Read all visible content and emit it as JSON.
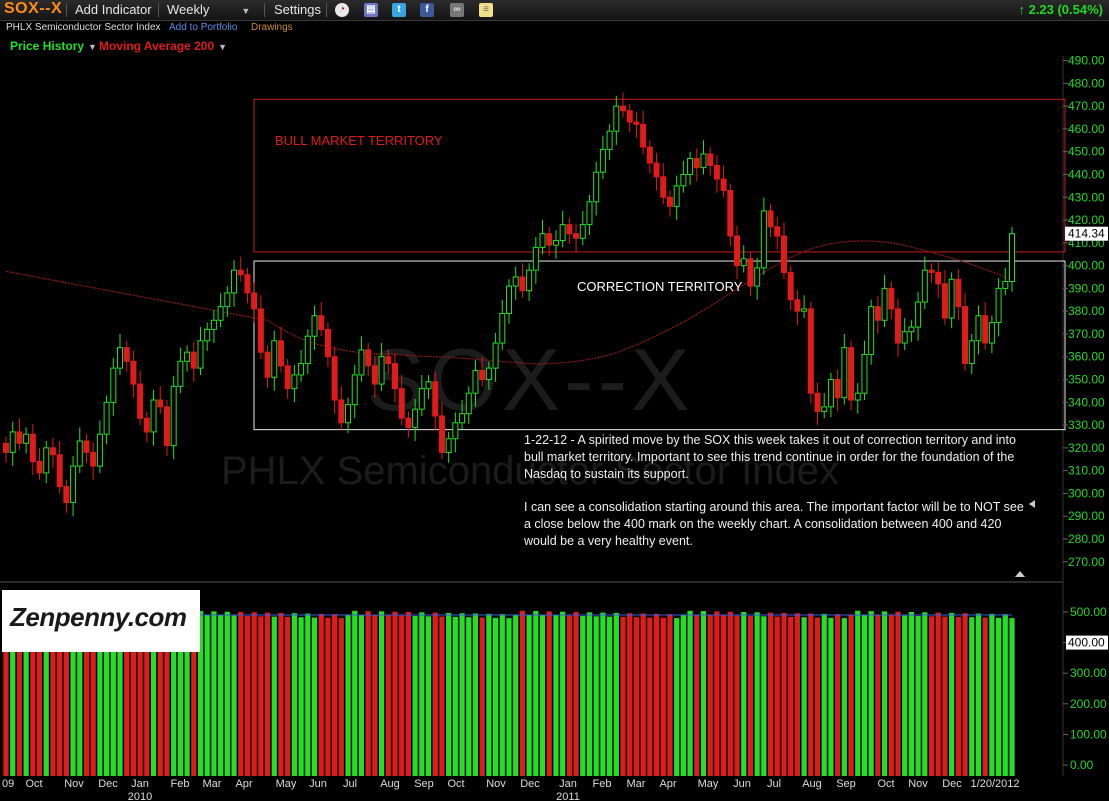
{
  "toolbar": {
    "symbol": "SOX--X",
    "add_indicator": "Add Indicator",
    "period": "Weekly",
    "settings": "Settings",
    "change": "↑ 2.23 (0.54%)"
  },
  "subbar": {
    "name": "PHLX Semiconductor Sector Index",
    "add_to_portfolio": "Add to Portfolio",
    "drawings": "Drawings"
  },
  "indicators": {
    "price_history": "Price History",
    "moving_average": "Moving Average 200"
  },
  "watermark": {
    "symbol": "SOX--X",
    "name": "PHLX Semiconductor Sector Index"
  },
  "annotations": {
    "bull": "BULL MARKET TERRITORY",
    "correction": "CORRECTION TERRITORY",
    "note_1": "1-22-12 - A spirited move by the SOX this week takes it out of correction territory and into bull market territory. Important to see this trend continue in order for the foundation of the Nasdaq to sustain its support.",
    "note_2": "I can see a consolidation starting around this area. The important factor will be to NOT see a close below the 400 mark on the weekly chart. A consolidation between 400 and 420 would be a very healthy event."
  },
  "logo_text": "Zenpenny.com",
  "colors": {
    "up": "#22e022",
    "down": "#e01b1b",
    "ma": "#8b1a1a",
    "axis_text": "#23d623",
    "symbol": "#ff8c1a",
    "volume_line": "#3b5bdb"
  },
  "chart_data": [
    {
      "type": "candlestick",
      "title": "SOX--X",
      "ylim": [
        262,
        492
      ],
      "y_ticks": [
        270,
        280,
        290,
        300,
        310,
        320,
        330,
        340,
        350,
        360,
        370,
        380,
        390,
        400,
        410,
        420,
        430,
        440,
        450,
        460,
        470,
        480,
        490
      ],
      "last_price_label": "414.34",
      "x_tick_labels": [
        "09",
        "Oct",
        "Nov",
        "Dec",
        "Jan",
        "Feb",
        "Mar",
        "Apr",
        "May",
        "Jun",
        "Jul",
        "Aug",
        "Sep",
        "Oct",
        "Nov",
        "Dec",
        "Jan",
        "Feb",
        "Mar",
        "Apr",
        "May",
        "Jun",
        "Jul",
        "Aug",
        "Sep",
        "Oct",
        "Nov",
        "Dec",
        "1/20/2012"
      ],
      "year_labels": [
        "2010",
        "2011"
      ],
      "close": [
        318,
        327,
        322,
        326,
        314,
        309,
        320,
        317,
        303,
        296,
        312,
        323,
        318,
        312,
        326,
        340,
        355,
        364,
        358,
        348,
        333,
        327,
        341,
        338,
        321,
        347,
        358,
        362,
        355,
        367,
        372,
        376,
        382,
        388,
        398,
        396,
        388,
        381,
        362,
        351,
        367,
        356,
        346,
        352,
        357,
        369,
        378,
        372,
        360,
        341,
        331,
        339,
        352,
        363,
        356,
        348,
        360,
        357,
        346,
        333,
        329,
        337,
        346,
        349,
        334,
        318,
        324,
        331,
        335,
        344,
        354,
        350,
        355,
        366,
        379,
        391,
        395,
        389,
        398,
        408,
        414,
        409,
        411,
        418,
        414,
        412,
        418,
        428,
        441,
        451,
        459,
        470,
        468,
        463,
        462,
        452,
        445,
        439,
        430,
        426,
        435,
        440,
        447,
        443,
        449,
        444,
        438,
        433,
        413,
        400,
        403,
        391,
        399,
        424,
        417,
        413,
        397,
        385,
        380,
        381,
        344,
        336,
        338,
        350,
        342,
        364,
        341,
        344,
        361,
        382,
        376,
        390,
        381,
        366,
        371,
        373,
        384,
        398,
        397,
        392,
        377,
        394,
        382,
        357,
        367,
        378,
        366,
        375,
        390,
        393,
        414
      ]
    },
    {
      "type": "bar",
      "title": "Volume",
      "ylim": [
        0,
        520
      ],
      "y_ticks": [
        0,
        100,
        200,
        300,
        400,
        500
      ],
      "y_tick_labels": [
        "0.00",
        "100.00",
        "200.00",
        "300.00",
        "400.00",
        "500.00"
      ],
      "last_value_label": "400.00",
      "reference_line": 490
    }
  ]
}
